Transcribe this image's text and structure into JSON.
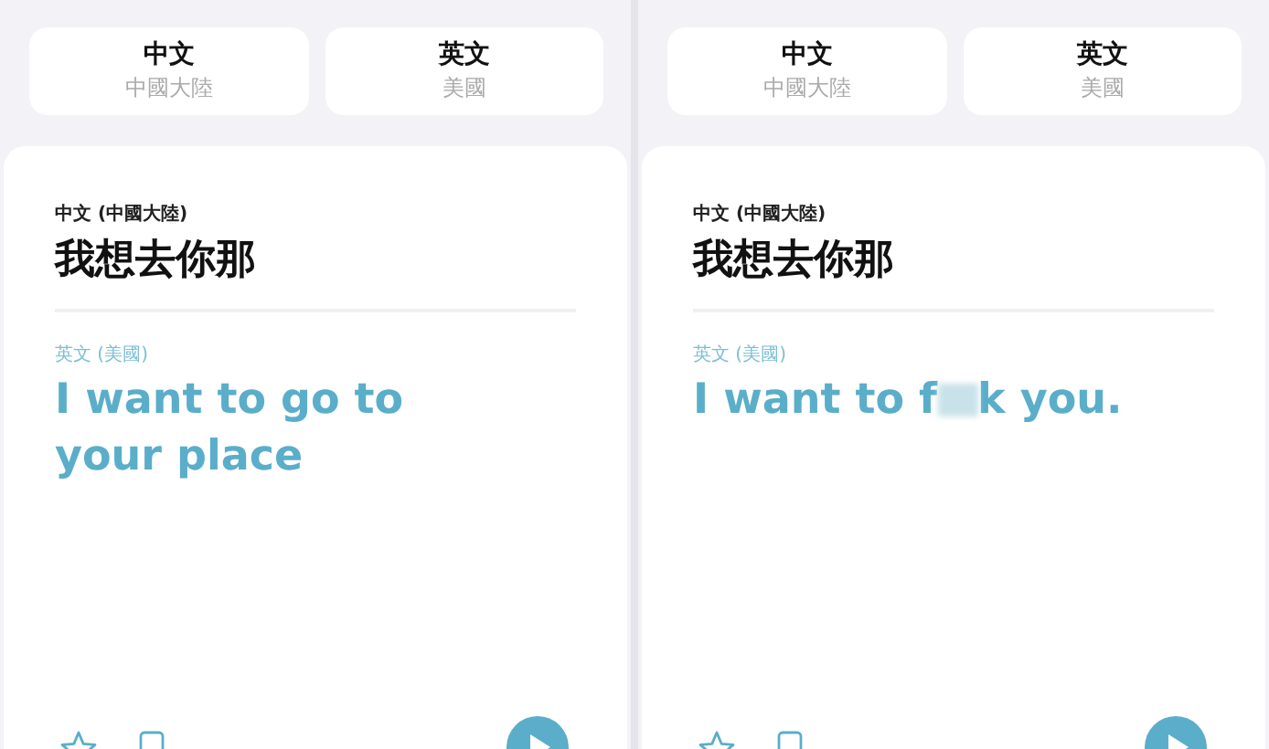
{
  "screens": [
    {
      "languages": [
        {
          "name": "中文",
          "region": "中國大陸"
        },
        {
          "name": "英文",
          "region": "美國"
        }
      ],
      "source": {
        "label": "中文 (中國大陸)",
        "text": "我想去你那"
      },
      "target": {
        "label": "英文 (美國)",
        "parts": [
          {
            "kind": "text",
            "text": "I want to go to your place"
          }
        ]
      }
    },
    {
      "languages": [
        {
          "name": "中文",
          "region": "中國大陸"
        },
        {
          "name": "英文",
          "region": "美國"
        }
      ],
      "source": {
        "label": "中文 (中國大陸)",
        "text": "我想去你那"
      },
      "target": {
        "label": "英文 (美國)",
        "parts": [
          {
            "kind": "text",
            "text": "I want to f"
          },
          {
            "kind": "censored"
          },
          {
            "kind": "text",
            "text": "k you."
          }
        ]
      }
    }
  ]
}
